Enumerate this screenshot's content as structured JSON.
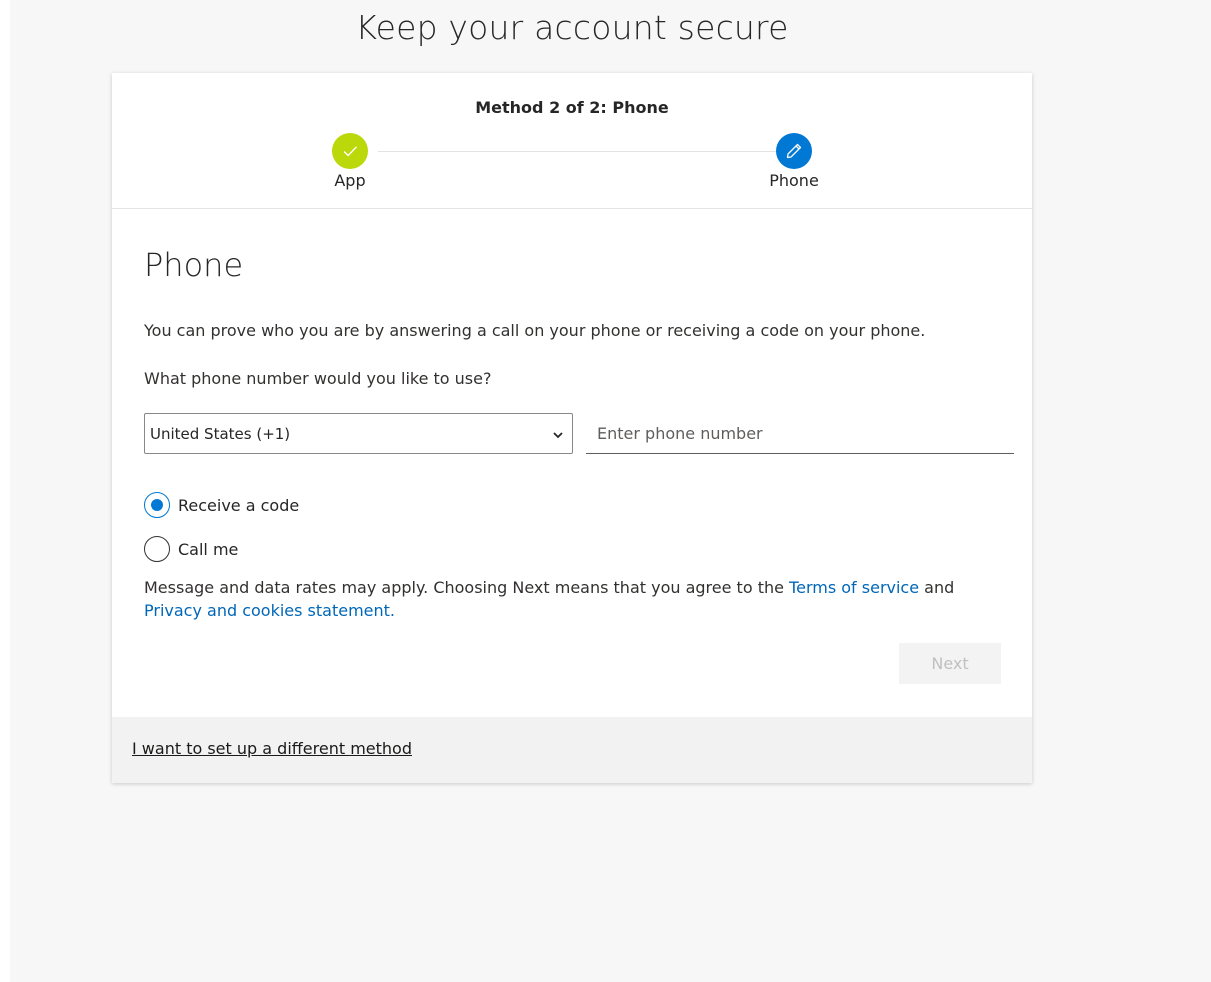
{
  "page": {
    "title": "Keep your account secure"
  },
  "progress": {
    "method_label": "Method 2 of 2: Phone",
    "steps": [
      {
        "label": "App",
        "state": "done",
        "icon": "checkmark-icon",
        "color": "#bad80a"
      },
      {
        "label": "Phone",
        "state": "current",
        "icon": "pencil-icon",
        "color": "#0078d4"
      }
    ]
  },
  "section": {
    "title": "Phone",
    "description": "You can prove who you are by answering a call on your phone or receiving a code on your phone.",
    "question": "What phone number would you like to use?"
  },
  "form": {
    "country_value": "United States (+1)",
    "phone_placeholder": "Enter phone number",
    "options": [
      {
        "label": "Receive a code",
        "checked": true
      },
      {
        "label": "Call me",
        "checked": false
      }
    ]
  },
  "terms": {
    "prefix": "Message and data rates may apply. Choosing Next means that you agree to the ",
    "tos_link": "Terms of service",
    "middle": " and ",
    "privacy_link": "Privacy and cookies statement."
  },
  "buttons": {
    "next_label": "Next"
  },
  "footer": {
    "alt_method_link": "I want to set up a different method"
  },
  "colors": {
    "accent": "#0078d4",
    "done": "#bad80a",
    "link": "#0067b8"
  }
}
